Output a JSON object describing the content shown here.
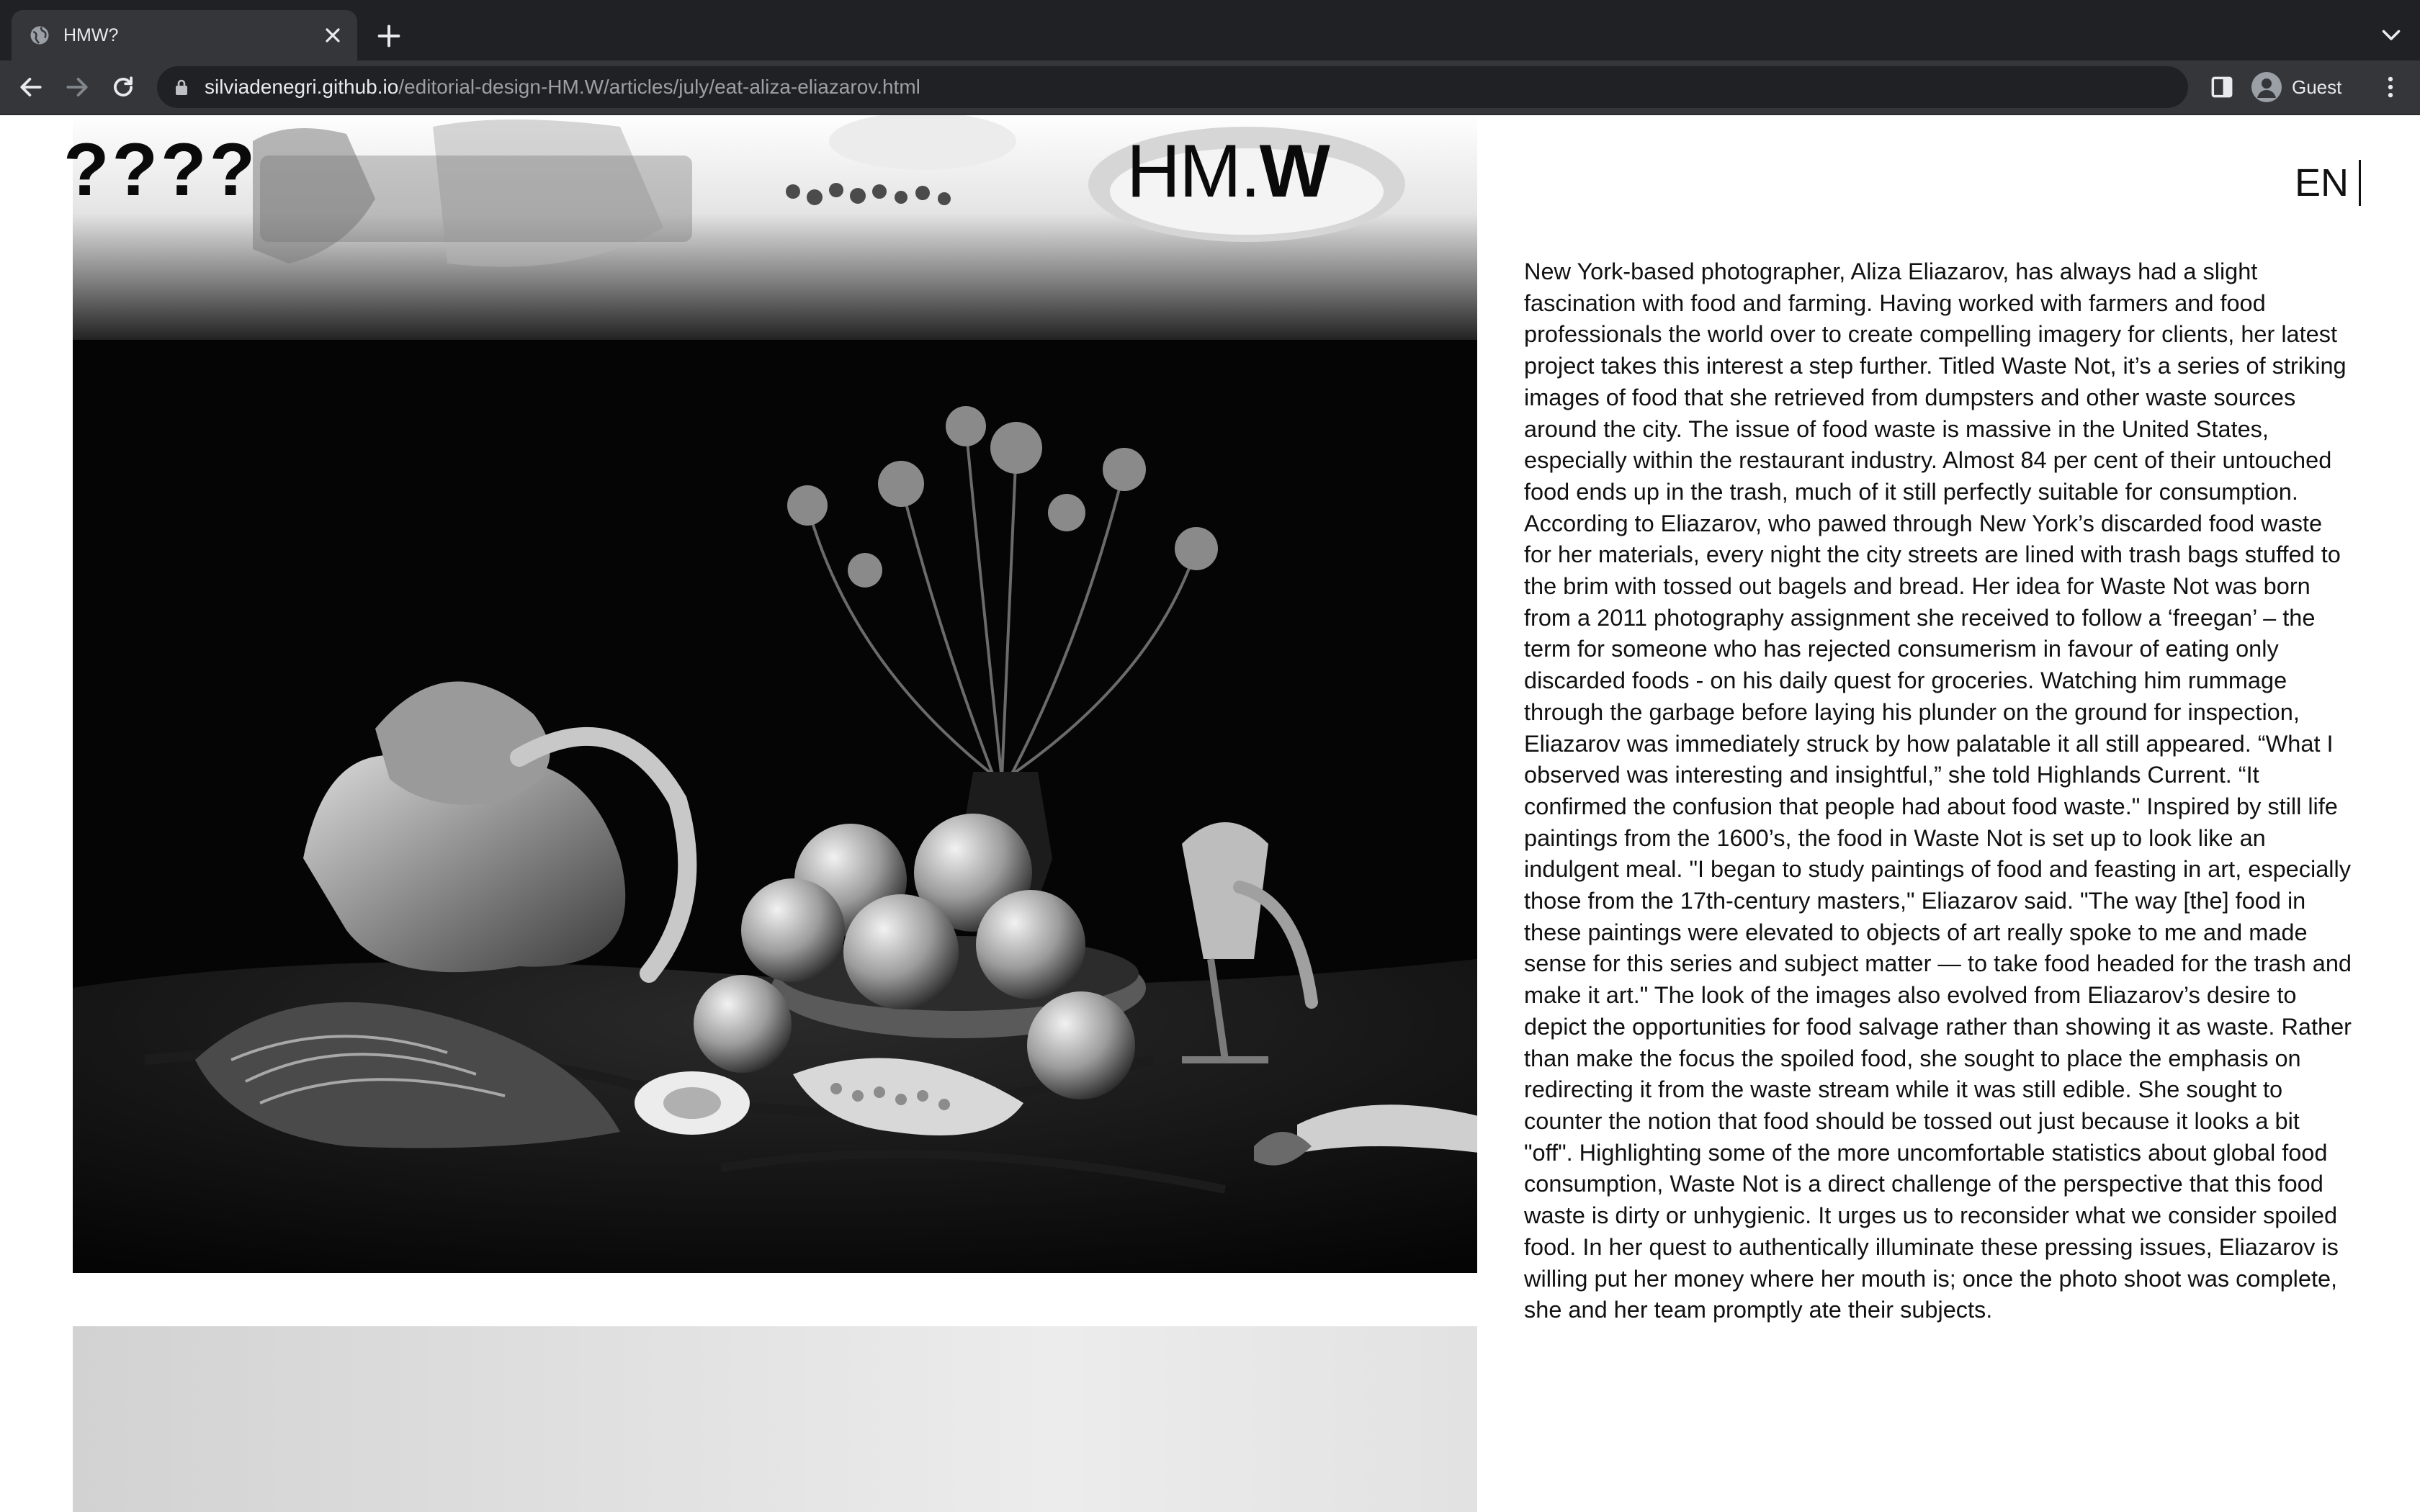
{
  "browser": {
    "tab_title": "HMW?",
    "url_host": "silviadenegri.github.io",
    "url_path": "/editorial-design-HM.W/articles/july/eat-aliza-eliazarov.html",
    "profile_label": "Guest",
    "icons": [
      "globe-icon",
      "close-icon",
      "plus-icon",
      "chevron-down-icon",
      "back-arrow-icon",
      "forward-arrow-icon",
      "reload-icon",
      "lock-icon",
      "side-panel-icon",
      "person-icon",
      "more-vert-icon"
    ]
  },
  "header": {
    "logo_left": "????",
    "logo_right_regular": "HM.",
    "logo_right_bold": "W",
    "language": "EN"
  },
  "article": {
    "body": "New York-based photographer, Aliza Eliazarov, has always had a slight fascination with food and farming. Having worked with farmers and food professionals the world over to create compelling imagery for clients, her latest project takes this interest a step further. Titled Waste Not, it’s a series of striking images of food that she retrieved from dumpsters and other waste sources around the city. The issue of food waste is massive in the United States, especially within the restaurant industry. Almost 84 per cent of their untouched food ends up in the trash, much of it still perfectly suitable for consumption. According to Eliazarov, who pawed through New York’s discarded food waste for her materials, every night the city streets are lined with trash bags stuffed to the brim with tossed out bagels and bread. Her idea for Waste Not was born from a 2011 photography assignment she received to follow a ‘freegan’ – the term for someone who has rejected consumerism in favour of eating only discarded foods - on his daily quest for groceries. Watching him rummage through the garbage before laying his plunder on the ground for inspection, Eliazarov was immediately struck by how palatable it all still appeared. “What I observed was interesting and insightful,” she told Highlands Current. “It confirmed the confusion that people had about food waste.\" Inspired by still life paintings from the 1600’s, the food in Waste Not is set up to look like an indulgent meal. \"I began to study paintings of food and feasting in art, especially those from the 17th-century masters,\" Eliazarov said. \"The way [the] food in these paintings were elevated to objects of art really spoke to me and made sense for this series and subject matter — to take food headed for the trash and make it art.\" The look of the images also evolved from Eliazarov’s desire to depict the opportunities for food salvage rather than showing it as waste. Rather than make the focus the spoiled food, she sought to place the emphasis on redirecting it from the waste stream while it was still edible. She sought to counter the notion that food should be tossed out just because it looks a bit \"off\". Highlighting some of the more uncomfortable statistics about global food consumption, Waste Not is a direct challenge of the perspective that this food waste is dirty or unhygienic. It urges us to reconsider what we consider spoiled food. In her quest to authentically illuminate these pressing issues, Eliazarov is willing put her money where her mouth is; once the photo shoot was complete, she and her team promptly ate their subjects."
  }
}
